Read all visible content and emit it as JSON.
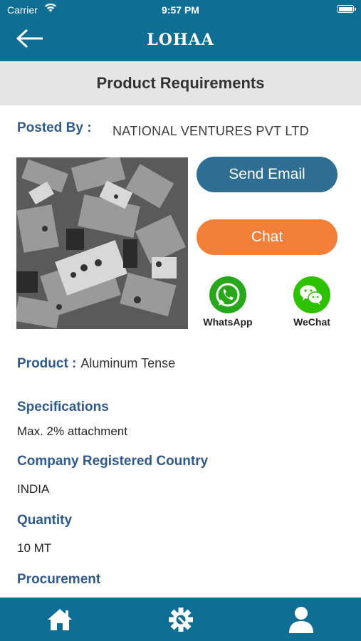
{
  "status_bar": {
    "carrier": "Carrier",
    "time": "9:57 PM"
  },
  "header": {
    "brand": "LOHAA",
    "back_icon": "arrow-left-icon"
  },
  "subheader": {
    "title": "Product Requirements"
  },
  "posted_by": {
    "label": "Posted By :",
    "value": "NATIONAL VENTURES PVT LTD"
  },
  "product_image": {
    "description": "scrap metal pile"
  },
  "actions": {
    "send_email_label": "Send Email",
    "chat_label": "Chat",
    "whatsapp_label": "WhatsApp",
    "wechat_label": "WeChat"
  },
  "product": {
    "label": "Product :",
    "value": "Aluminum Tense"
  },
  "details": [
    {
      "label": "Specifications",
      "value": "Max. 2% attachment"
    },
    {
      "label": "Company Registered Country",
      "value": "INDIA"
    },
    {
      "label": "Quantity",
      "value": "10 MT"
    },
    {
      "label": "Procurement",
      "value": ""
    }
  ],
  "bottom_nav": [
    "home-icon",
    "settings-gear-icon",
    "profile-icon"
  ],
  "colors": {
    "primary": "#0e6e94",
    "email_button": "#2f6e93",
    "chat_button": "#f27f37",
    "label_blue": "#2e5a8e",
    "whatsapp": "#29a71a",
    "wechat": "#2dc100"
  }
}
